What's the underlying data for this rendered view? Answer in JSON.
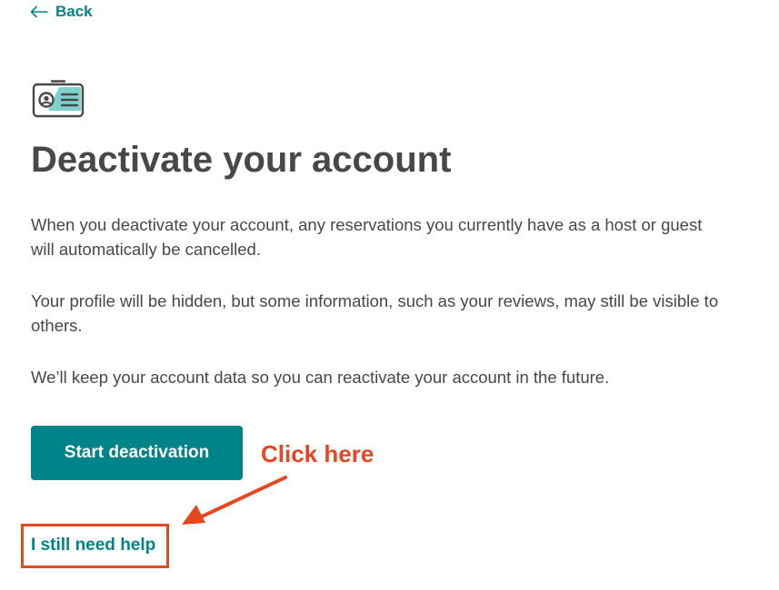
{
  "nav": {
    "back_label": "Back"
  },
  "header": {
    "icon": "id-card-icon",
    "title": "Deactivate your account"
  },
  "body": {
    "paragraph_1": "When you deactivate your account, any reservations you currently have as a host or guest will automatically be cancelled.",
    "paragraph_2": "Your profile will be hidden, but some information, such as your reviews, may still be visible to others.",
    "paragraph_3": "We’ll keep your account data so you can reactivate your account in the future."
  },
  "actions": {
    "start_deactivation_label": "Start deactivation",
    "help_link_label": "I still need help"
  },
  "annotation": {
    "text": "Click here",
    "color": "#e8461e"
  },
  "colors": {
    "accent": "#008489",
    "text": "#484848",
    "annotation": "#e8461e"
  }
}
